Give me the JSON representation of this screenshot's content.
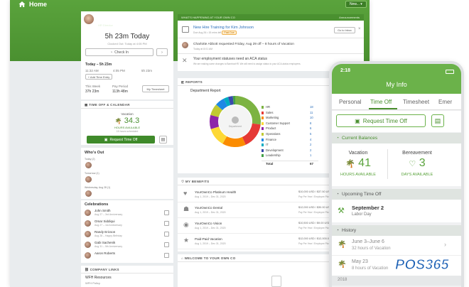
{
  "topbar": {
    "title": "Home",
    "new_button": "New..."
  },
  "profile": {
    "name": "Danielle John",
    "role": "HR Director",
    "time_today": "5h 23m Today",
    "clocked_out": "Clocked Out: Today at 4:05 PM",
    "checkin_label": "Check In",
    "today_label": "Today – 5h 23m",
    "entry1_start": "11:32 AM",
    "entry1_end": "4:05 PM",
    "entry1_dur": "5h 23m",
    "add_entry": "+ Add Time Entry",
    "this_week_label": "This Week",
    "this_week_value": "37h 23m",
    "pay_period_label": "Pay Period",
    "pay_period_value": "113h 48m",
    "my_timesheet": "My Timesheet"
  },
  "timeoff": {
    "title": "Time Off & Calendar",
    "type": "Vacation",
    "value": "34.3",
    "unit": "Hours Available",
    "sub": "15 hours scheduled",
    "request_label": "Request Time Off"
  },
  "whos_out": {
    "title": "Who's Out",
    "today": "Today (2)",
    "tomorrow": "Tomorrow (1)",
    "next": "Wednesday, Aug 28 (1)"
  },
  "celebrations": {
    "title": "Celebrations",
    "items": [
      {
        "name": "John Smith",
        "desc": "Aug 27 – 3rd Anniversary"
      },
      {
        "name": "Omar Siddiqui",
        "desc": "Aug 27 – 1st Anniversary"
      },
      {
        "name": "Randy Ericson",
        "desc": "Aug 28 – Happy Birthday"
      },
      {
        "name": "Gabi Sachenik",
        "desc": "Aug 31 – 5th Anniversary"
      },
      {
        "name": "Aaron Roberts",
        "desc": ""
      }
    ]
  },
  "company_links": {
    "title": "Company Links",
    "item1": "WFH Resources",
    "item1_sub": "WFH Policy"
  },
  "whats_happening": {
    "title": "What's Happening at Your Own Co",
    "announcements": "Announcements",
    "item1_title": "New Hire Training for Kim Johnson",
    "item1_sub": "Due Aug 26 • 15 mins left",
    "item1_badge": "Past Due",
    "item1_button": "Go to Inbox",
    "item2_text": "Charlotte Abbott requested Friday, Aug 29 off – 8 hours of Vacation",
    "item2_sub": "Today at 8:01 AM",
    "item3_text": "Your employment statuses need an ACA status",
    "item3_sub": "We are making some changes to BambooHR. We will need to assign status to your ACA-status employees."
  },
  "reports": {
    "title": "Reports",
    "card_title": "Department Report",
    "donut_center": "Department",
    "legend": [
      {
        "label": "HR",
        "value": "18",
        "color": "#7cb342"
      },
      {
        "label": "Sales",
        "value": "11",
        "color": "#e53935"
      },
      {
        "label": "Marketing",
        "value": "10",
        "color": "#fb8c00"
      },
      {
        "label": "Customer Support",
        "value": "8",
        "color": "#fdd835"
      },
      {
        "label": "Product",
        "value": "6",
        "color": "#8e24aa"
      },
      {
        "label": "Operations",
        "value": "5",
        "color": "#c0ca33"
      },
      {
        "label": "Finance",
        "value": "4",
        "color": "#1e88e5"
      },
      {
        "label": "IT",
        "value": "2",
        "color": "#00acc1"
      },
      {
        "label": "Development",
        "value": "2",
        "color": "#3949ab"
      },
      {
        "label": "Leadership",
        "value": "1",
        "color": "#43a047"
      }
    ],
    "total_label": "Total",
    "total_value": "67"
  },
  "benefits": {
    "title": "My Benefits",
    "items": [
      {
        "name": "YourOwnCo Platinum Health",
        "date": "Aug 1, 2019 – Dec 31, 2020",
        "cost": "$10,000 USD / $37.50 USD",
        "sub": "Pay Per Year / Employee Plus"
      },
      {
        "name": "YourOwnCo Dental",
        "date": "Aug 1, 2019 – Dec 31, 2020",
        "cost": "$12,000 USD / $30.00 USD",
        "sub": "Pay Per Year / Employee Plus"
      },
      {
        "name": "YourOwnCo Vision",
        "date": "Aug 1, 2019 – Dec 31, 2020",
        "cost": "$10,500 USD / $9.00 USD",
        "sub": "Pay Per Year / Employee Plus"
      },
      {
        "name": "Paid-Paid Vacation",
        "date": "Aug 1, 2019 – Dec 31, 2020",
        "cost": "$12,000 USD / $12,000.00 USD",
        "sub": "Pay Per Year / Employee Plus"
      }
    ]
  },
  "welcome": {
    "title": "Welcome to Your Own Co"
  },
  "phone": {
    "time": "2:18",
    "title": "My Info",
    "tabs": [
      "Personal",
      "Time Off",
      "Timesheet",
      "Emer"
    ],
    "request_label": "Request Time Off",
    "balances_title": "Current Balances",
    "vacation_label": "Vacation",
    "vacation_value": "41",
    "vacation_unit": "HOURS AVAILABLE",
    "bereavement_label": "Bereavement",
    "bereavement_value": "3",
    "bereavement_unit": "DAYS AVAILABLE",
    "upcoming_title": "Upcoming Time Off",
    "upcoming_date": "September 2",
    "upcoming_sub": "Labor Day",
    "history_title": "History",
    "hist1_date": "June 3–June 6",
    "hist1_sub": "32 hours of Vacation",
    "hist2_date": "May 23",
    "hist2_sub": "8 hours of Vacation",
    "hist_year": "2018"
  },
  "watermark": {
    "text": "POS365"
  },
  "colors": {
    "green": "#5aa33c",
    "phone_green": "#6bb24a",
    "accent_blue": "#2a6ebb"
  }
}
